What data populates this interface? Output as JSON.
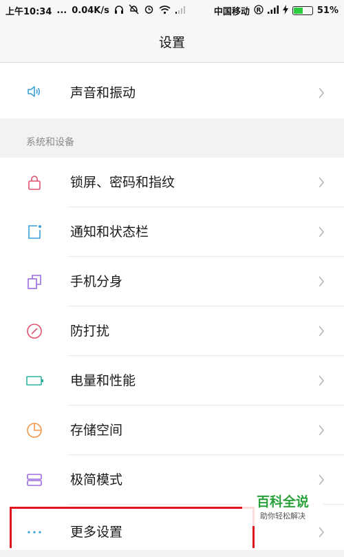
{
  "status_bar": {
    "time": "上午10:34",
    "dots": "...",
    "speed": "0.04K/s",
    "carrier": "中国移动",
    "battery": "51%",
    "battery_level": 0.51
  },
  "header": {
    "title": "设置"
  },
  "items_top": [
    {
      "label": "声音和振动",
      "icon": "speaker-icon"
    }
  ],
  "section": {
    "title": "系统和设备"
  },
  "items": [
    {
      "label": "锁屏、密码和指纹",
      "icon": "lock-icon"
    },
    {
      "label": "通知和状态栏",
      "icon": "notification-icon"
    },
    {
      "label": "手机分身",
      "icon": "second-space-icon"
    },
    {
      "label": "防打扰",
      "icon": "do-not-disturb-icon"
    },
    {
      "label": "电量和性能",
      "icon": "battery-icon"
    },
    {
      "label": "存储空间",
      "icon": "storage-icon"
    },
    {
      "label": "极简模式",
      "icon": "lite-mode-icon"
    },
    {
      "label": "更多设置",
      "icon": "more-icon"
    }
  ],
  "watermark": {
    "title": "百科全说",
    "subtitle": "助你轻松解决"
  },
  "colors": {
    "speaker": "#3aa0d8",
    "lock": "#e0506e",
    "notification": "#3aa0d8",
    "second_space": "#9b6be0",
    "dnd": "#e0506e",
    "battery": "#2ab3a0",
    "storage": "#f0954a",
    "lite": "#9b6be0",
    "more": "#3aa0d8",
    "highlight": "#e0151c"
  }
}
